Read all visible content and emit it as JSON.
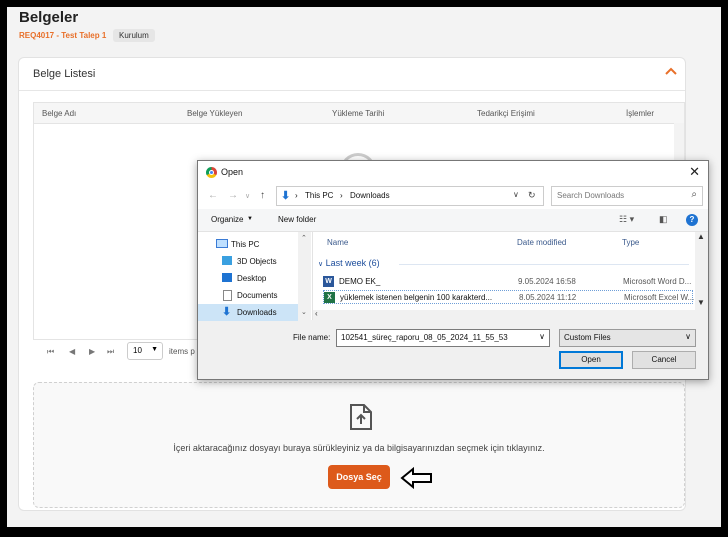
{
  "page": {
    "title": "Belgeler",
    "request_code": "REQ4017 - Test Talep 1",
    "tag": "Kurulum"
  },
  "card": {
    "title": "Belge Listesi",
    "columns": [
      "Belge Adı",
      "Belge Yükleyen",
      "Yükleme Tarihi",
      "Tedarikçi Erişimi",
      "İşlemler"
    ],
    "pager": {
      "page_size": "10",
      "label": "items p"
    }
  },
  "dropzone": {
    "text": "İçeri aktaracağınız dosyayı buraya sürükleyiniz ya da bilgisayarınızdan seçmek için tıklayınız.",
    "button_label": "Dosya Seç"
  },
  "dialog": {
    "title": "Open",
    "path": [
      "This PC",
      "Downloads"
    ],
    "search_placeholder": "Search Downloads",
    "organize_label": "Organize",
    "new_folder_label": "New folder",
    "nav_items": [
      {
        "label": "This PC",
        "icon": "monitor-icon"
      },
      {
        "label": "3D Objects",
        "icon": "cube-icon"
      },
      {
        "label": "Desktop",
        "icon": "desktop-icon"
      },
      {
        "label": "Documents",
        "icon": "document-icon"
      },
      {
        "label": "Downloads",
        "icon": "download-icon",
        "selected": true
      }
    ],
    "headers": {
      "name": "Name",
      "date": "Date modified",
      "type": "Type"
    },
    "group_label": "Last week (6)",
    "files": [
      {
        "name": "DEMO EK_",
        "date": "9.05.2024 16:58",
        "type": "Microsoft Word D...",
        "icon": "word-icon",
        "icon_color": "#2b579a",
        "icon_letter": "W"
      },
      {
        "name": "yüklemek istenen belgenin 100 karakterd...",
        "date": "8.05.2024 11:12",
        "type": "Microsoft Excel W...",
        "icon": "excel-icon",
        "icon_color": "#217346",
        "icon_letter": "X"
      }
    ],
    "file_name_label": "File name:",
    "file_name_value": "102541_süreç_raporu_08_05_2024_11_55_53",
    "file_type": "Custom Files",
    "open_label": "Open",
    "cancel_label": "Cancel"
  }
}
